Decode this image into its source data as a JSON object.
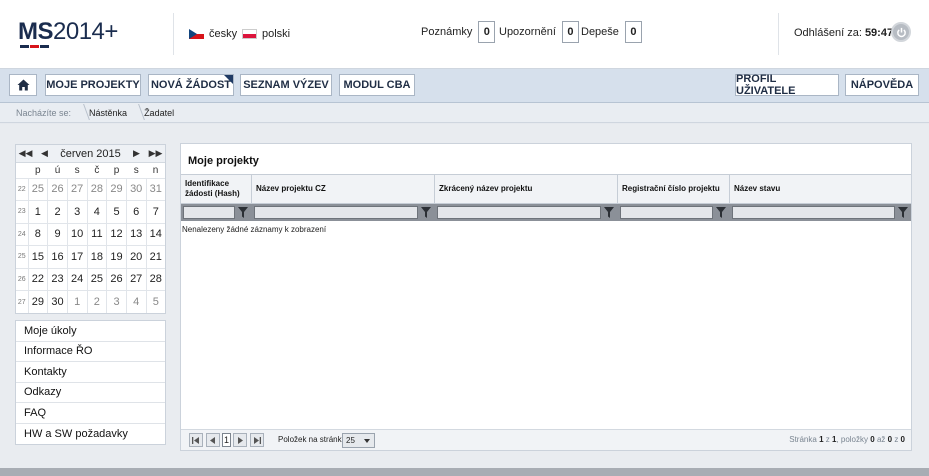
{
  "header": {
    "logo_ms": "MS",
    "logo_year": "2014+",
    "languages": [
      {
        "label": "česky",
        "flag": "cz-flag-icon"
      },
      {
        "label": "polski",
        "flag": "pl-flag-icon"
      }
    ],
    "counters": [
      {
        "label": "Poznámky",
        "value": "0"
      },
      {
        "label": "Upozornění",
        "value": "0"
      },
      {
        "label": "Depeše",
        "value": "0"
      }
    ],
    "logout_label": "Odhlášení za:",
    "logout_time": "59:47",
    "power_icon": "power-icon"
  },
  "nav": {
    "home_icon": "home-icon",
    "items": [
      "MOJE PROJEKTY",
      "NOVÁ ŽÁDOST",
      "SEZNAM VÝZEV",
      "MODUL CBA"
    ],
    "right_items": [
      "PROFIL UŽIVATELE",
      "NÁPOVĚDA"
    ]
  },
  "breadcrumb": {
    "label": "Nacházíte se:",
    "items": [
      "Nástěnka",
      "Žadatel"
    ]
  },
  "calendar": {
    "month": "červen 2015",
    "weekdays": [
      "p",
      "ú",
      "s",
      "č",
      "p",
      "s",
      "n"
    ],
    "weeks": [
      {
        "wk": "22",
        "days": [
          "25",
          "26",
          "27",
          "28",
          "29",
          "30",
          "31"
        ]
      },
      {
        "wk": "23",
        "days": [
          "1",
          "2",
          "3",
          "4",
          "5",
          "6",
          "7"
        ]
      },
      {
        "wk": "24",
        "days": [
          "8",
          "9",
          "10",
          "11",
          "12",
          "13",
          "14"
        ]
      },
      {
        "wk": "25",
        "days": [
          "15",
          "16",
          "17",
          "18",
          "19",
          "20",
          "21"
        ]
      },
      {
        "wk": "26",
        "days": [
          "22",
          "23",
          "24",
          "25",
          "26",
          "27",
          "28"
        ]
      },
      {
        "wk": "27",
        "days": [
          "29",
          "30",
          "1",
          "2",
          "3",
          "4",
          "5"
        ]
      }
    ]
  },
  "side_menu": [
    "Moje úkoly",
    "Informace ŘO",
    "Kontakty",
    "Odkazy",
    "FAQ",
    "HW a SW požadavky"
  ],
  "projects": {
    "title": "Moje projekty",
    "columns": [
      "Identifikace žádosti (Hash)",
      "Název projektu CZ",
      "Zkrácený název projektu",
      "Registrační číslo projektu",
      "Název stavu"
    ],
    "empty_message": "Nenalezeny žádné záznamy k zobrazení",
    "pager": {
      "page": "1",
      "per_page_label": "Položek na stránku",
      "per_page": "25",
      "info_prefix": "Stránka",
      "info_page": "1",
      "info_of": "z",
      "info_pages": "1",
      "info_items": ", položky",
      "info_from": "0",
      "info_to_word": "až",
      "info_to": "0",
      "info_total_word": "z",
      "info_total": "0"
    }
  },
  "colors": {
    "accent_dark": "#1f3a64",
    "navbar_bg": "#d6e0ec",
    "flag_red": "#d7141a"
  }
}
